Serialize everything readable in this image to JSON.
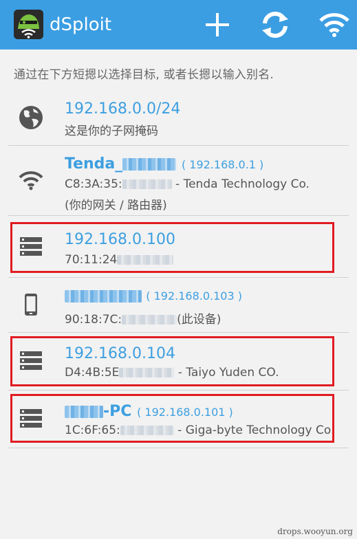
{
  "actionbar": {
    "title": "dSploit",
    "bg_color": "#3b9ee3",
    "actions": [
      {
        "name": "add-icon"
      },
      {
        "name": "refresh-icon"
      },
      {
        "name": "wifi-icon"
      }
    ]
  },
  "hint": "通过在下方短摁以选择目标, 或者长摁以输入别名.",
  "targets": [
    {
      "icon": "globe-icon",
      "title": "192.168.0.0/24",
      "subtitle": "这是你的子网掩码"
    },
    {
      "icon": "wifi-icon",
      "title": "Tenda_",
      "ip": "( 192.168.0.1 )",
      "mac_prefix": "C8:3A:35:",
      "vendor": " - Tenda Technology Co.",
      "note": "(你的网关 / 路由器)"
    },
    {
      "icon": "server-icon",
      "title": "192.168.0.100",
      "mac_prefix": "70:11:24",
      "highlighted": true
    },
    {
      "icon": "phone-icon",
      "ip": "( 192.168.0.103 )",
      "mac_prefix": "90:18:7C:",
      "vendor": "(此设备)"
    },
    {
      "icon": "server-icon",
      "title": "192.168.0.104",
      "mac_prefix": "D4:4B:5E",
      "vendor": " - Taiyo Yuden CO.",
      "highlighted": true
    },
    {
      "icon": "server-icon",
      "title": "-PC",
      "ip": "( 192.168.0.101 )",
      "mac_prefix": "1C:6F:65:",
      "vendor": " - Giga-byte Technology Co.",
      "highlighted": true
    }
  ],
  "watermark": "drops.wooyun.org",
  "colors": {
    "accent": "#3d9fe0",
    "highlight": "#e01b22"
  }
}
